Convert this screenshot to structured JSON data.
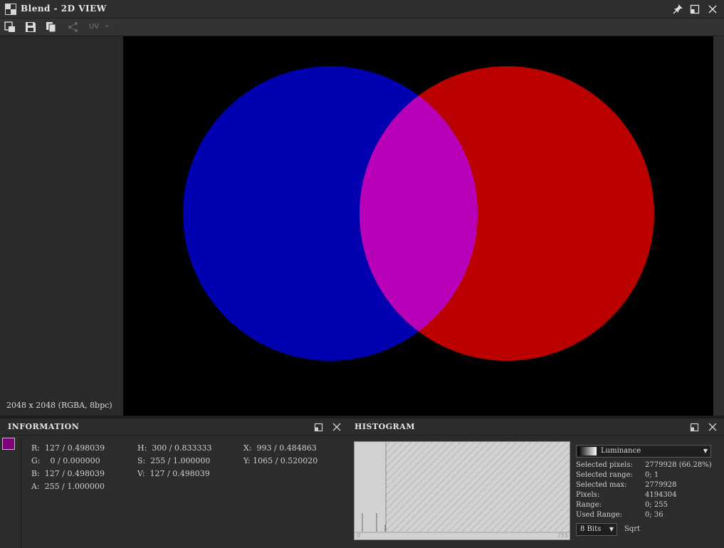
{
  "window": {
    "title": "Blend - 2D VIEW"
  },
  "toolbar": {
    "uv_label": "UV"
  },
  "viewport": {
    "resolution": "2048 x 2048 (RGBA, 8bpc)"
  },
  "information": {
    "title": "INFORMATION",
    "swatch_color": "#7f007f",
    "cells": [
      {
        "label": "R:",
        "value": "127 / 0.498039"
      },
      {
        "label": "G:",
        "value": "  0 / 0.000000"
      },
      {
        "label": "B:",
        "value": "127 / 0.498039"
      },
      {
        "label": "A:",
        "value": "255 / 1.000000"
      },
      {
        "label": "H:",
        "value": "300 / 0.833333"
      },
      {
        "label": "S:",
        "value": "255 / 1.000000"
      },
      {
        "label": "V:",
        "value": "127 / 0.498039"
      },
      {
        "label": "X:",
        "value": " 993 / 0.484863"
      },
      {
        "label": "Y:",
        "value": "1065 / 0.520020"
      }
    ]
  },
  "histogram": {
    "title": "HISTOGRAM",
    "axis_min": "0",
    "axis_max": "255",
    "channel": "Luminance",
    "bits": "8 Bits",
    "sqrt_label": "Sqrt",
    "stats": [
      {
        "label": "Selected pixels:",
        "value": "2779928 (66.28%)"
      },
      {
        "label": "Selected range:",
        "value": "0; 1"
      },
      {
        "label": "Selected max:",
        "value": "2779928"
      },
      {
        "label": "Pixels:",
        "value": "4194304"
      },
      {
        "label": "Range:",
        "value": "0; 255"
      },
      {
        "label": "Used Range:",
        "value": "0; 36"
      }
    ]
  },
  "colors": {
    "blue_circle": "#0000b0",
    "red_circle": "#bb0000",
    "overlap": "#b800b8"
  }
}
